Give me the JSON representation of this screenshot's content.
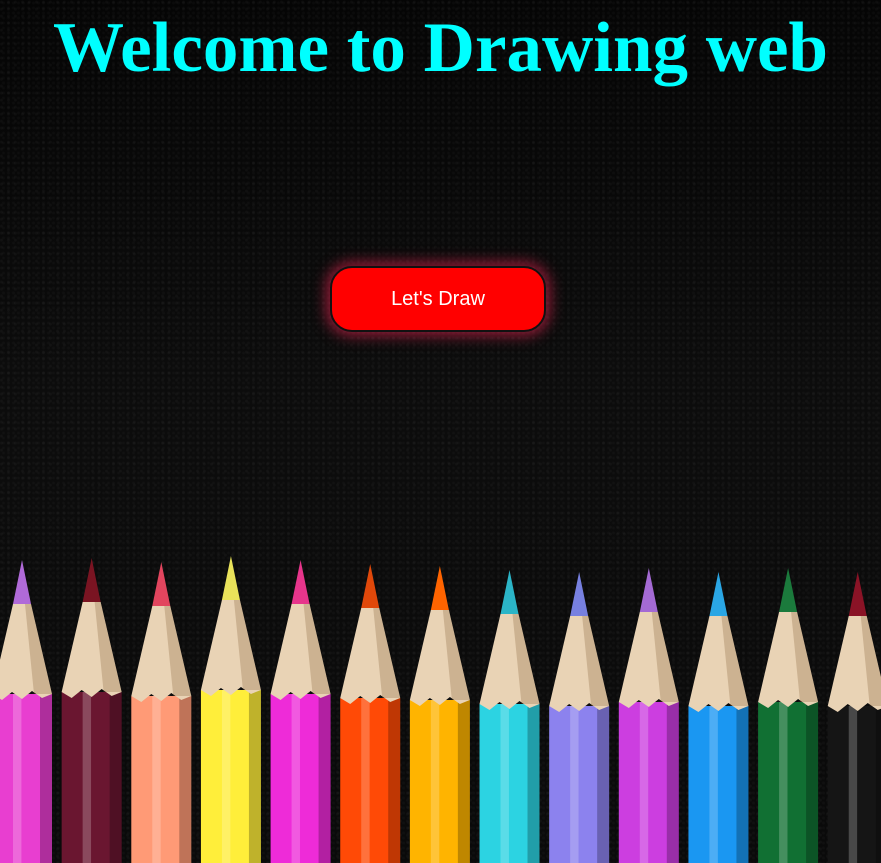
{
  "page": {
    "title": "Welcome to Drawing web",
    "button_label": "Let's Draw"
  },
  "colors": {
    "title": "#00ffff",
    "button": "#ff0000",
    "background": "#070707"
  },
  "pencils": [
    {
      "name": "pink-pencil",
      "body": "#e83ed0",
      "tip": "#b06ad8"
    },
    {
      "name": "maroon-pencil",
      "body": "#6a1630",
      "tip": "#7a1422"
    },
    {
      "name": "peach-pencil",
      "body": "#ff9a76",
      "tip": "#e2455e"
    },
    {
      "name": "yellow-pencil",
      "body": "#ffee3a",
      "tip": "#e9e25a"
    },
    {
      "name": "magenta-pencil",
      "body": "#ee2bd8",
      "tip": "#e7358b"
    },
    {
      "name": "orange-pencil",
      "body": "#ff4a06",
      "tip": "#e0480a"
    },
    {
      "name": "gold-pencil",
      "body": "#ffb400",
      "tip": "#ff6400"
    },
    {
      "name": "turquoise-pencil",
      "body": "#2cd3e2",
      "tip": "#2bb5c7"
    },
    {
      "name": "lavender-pencil",
      "body": "#8c82ee",
      "tip": "#7780e0"
    },
    {
      "name": "violet-pencil",
      "body": "#cc3ee0",
      "tip": "#a46ad4"
    },
    {
      "name": "blue-pencil",
      "body": "#1a97f2",
      "tip": "#2aa6e4"
    },
    {
      "name": "green-pencil",
      "body": "#117033",
      "tip": "#1b7a3c"
    },
    {
      "name": "black-pencil",
      "body": "#151515",
      "tip": "#8a1326"
    }
  ]
}
